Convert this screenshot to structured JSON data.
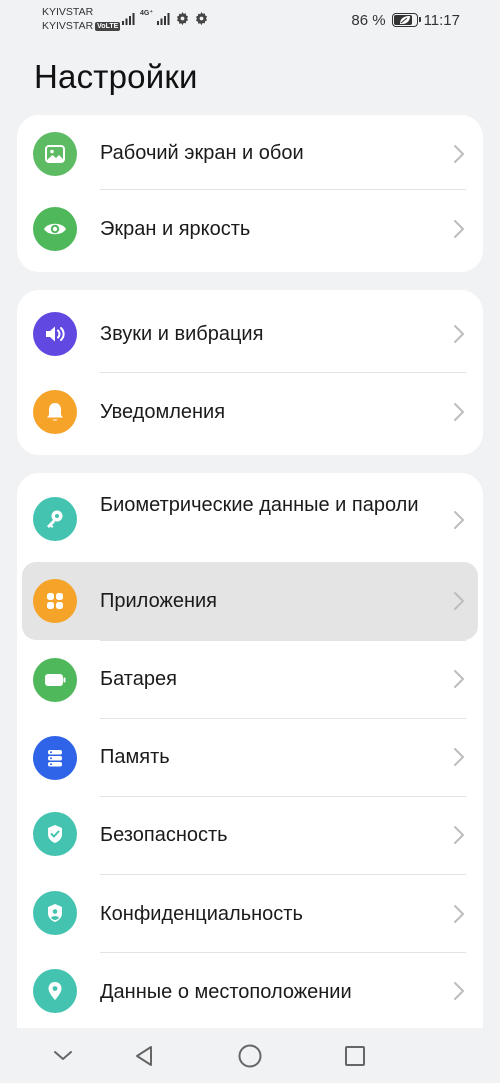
{
  "status_bar": {
    "carrier_1": "KYIVSTAR",
    "carrier_2": "KYIVSTAR",
    "volte_badge": "VoLTE",
    "network_type": "4G⁺",
    "battery_percent": "86 %",
    "battery_level": 0.86,
    "time": "11:17"
  },
  "page": {
    "title": "Настройки"
  },
  "groups": [
    {
      "items": [
        {
          "label": "Рабочий экран и обои",
          "icon": "image-icon",
          "color": "#5dbb63"
        },
        {
          "label": "Экран и яркость",
          "icon": "eye-icon",
          "color": "#4fb85a"
        }
      ]
    },
    {
      "items": [
        {
          "label": "Звуки и вибрация",
          "icon": "speaker-icon",
          "color": "#6048e0"
        },
        {
          "label": "Уведомления",
          "icon": "bell-icon",
          "color": "#f6a32a"
        }
      ]
    },
    {
      "items": [
        {
          "label": "Биометрические данные и пароли",
          "icon": "key-icon",
          "color": "#44c4b0"
        },
        {
          "label": "Приложения",
          "icon": "apps-grid-icon",
          "color": "#f6a32a",
          "highlighted": true
        },
        {
          "label": "Батарея",
          "icon": "battery-icon",
          "color": "#4fb85a"
        },
        {
          "label": "Память",
          "icon": "storage-icon",
          "color": "#2f63e8"
        },
        {
          "label": "Безопасность",
          "icon": "shield-check-icon",
          "color": "#44c4b0"
        },
        {
          "label": "Конфиденциальность",
          "icon": "privacy-shield-icon",
          "color": "#44c4b0"
        },
        {
          "label": "Данные о местоположении",
          "icon": "location-pin-icon",
          "color": "#44c4b0"
        }
      ]
    }
  ],
  "nav_bar": {
    "items": [
      "chevron-down-icon",
      "back-triangle-icon",
      "home-circle-icon",
      "recents-square-icon"
    ]
  }
}
